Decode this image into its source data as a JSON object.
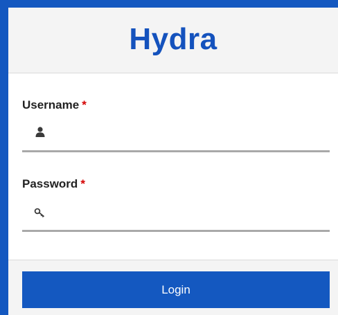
{
  "app": {
    "title": "Hydra"
  },
  "form": {
    "username": {
      "label": "Username",
      "required_mark": "*",
      "value": "",
      "placeholder": "",
      "icon": "user-icon"
    },
    "password": {
      "label": "Password",
      "required_mark": "*",
      "value": "",
      "placeholder": "",
      "icon": "key-icon"
    }
  },
  "actions": {
    "login_label": "Login"
  },
  "colors": {
    "brand": "#1452bd",
    "accent": "#1458c0",
    "required": "#d40000"
  }
}
